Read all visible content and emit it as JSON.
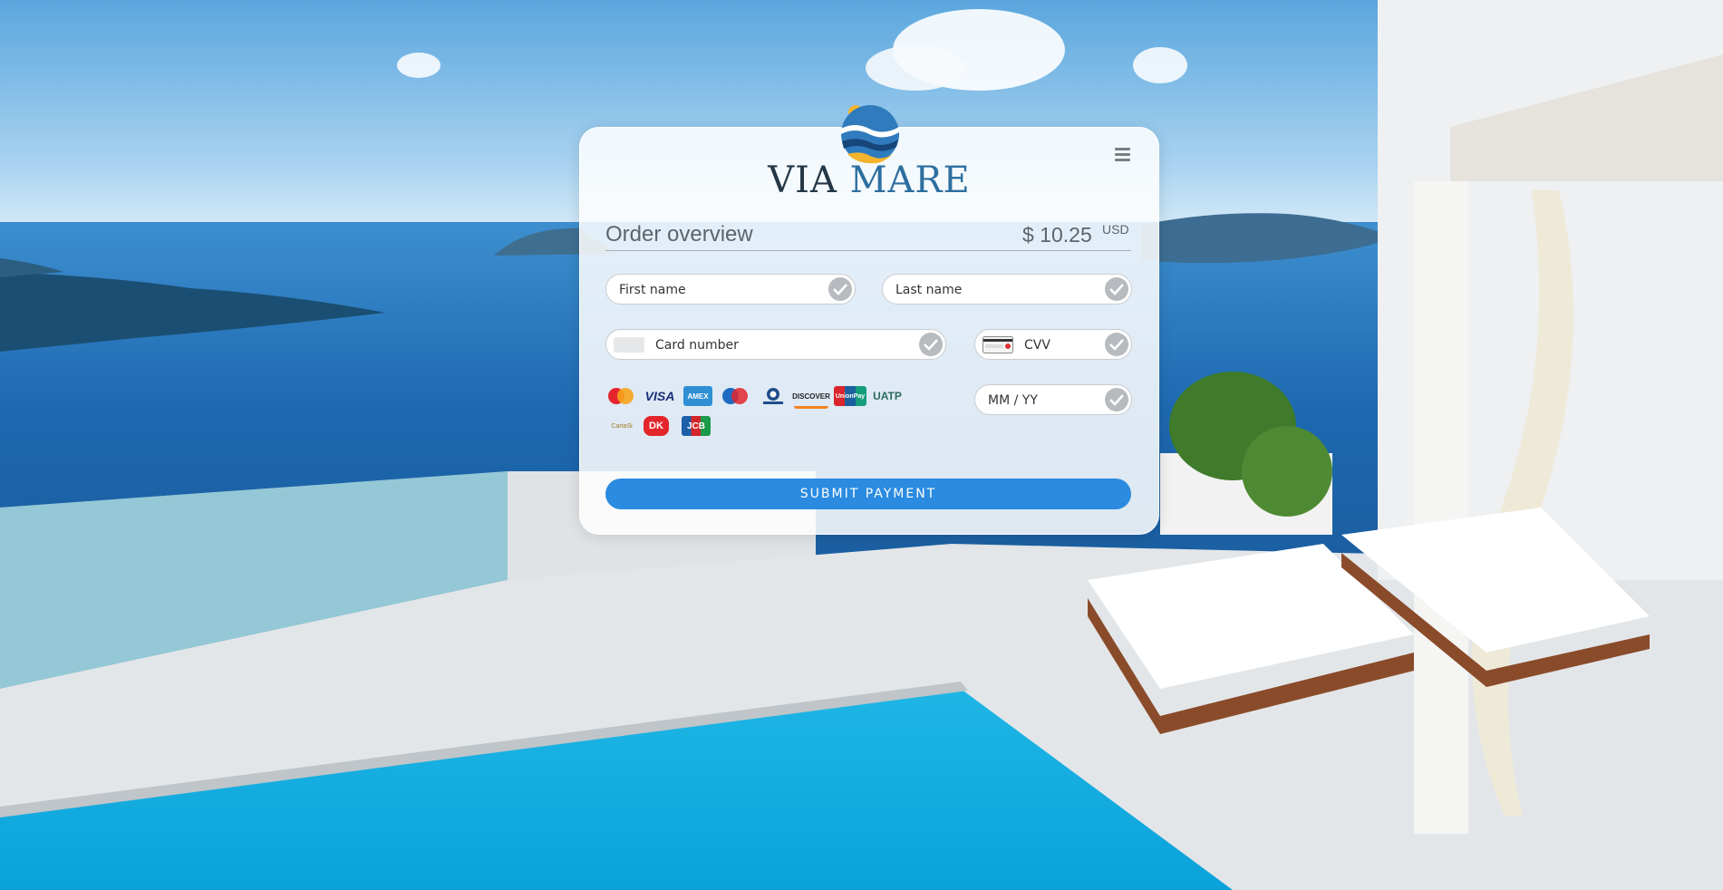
{
  "brand": {
    "name_part1": "VIA",
    "name_part2": "MARE",
    "logo_icon": "sun-waves-emblem-icon"
  },
  "header": {
    "menu_icon": "hamburger-menu-icon"
  },
  "order": {
    "title": "Order overview",
    "amount": "$ 10.25",
    "currency": "USD"
  },
  "form": {
    "first_name": {
      "placeholder": "First name",
      "value": ""
    },
    "last_name": {
      "placeholder": "Last name",
      "value": ""
    },
    "card_number": {
      "placeholder": "Card number",
      "value": ""
    },
    "cvv": {
      "placeholder": "CVV",
      "value": ""
    },
    "expiry": {
      "placeholder": "MM / YY",
      "value": ""
    }
  },
  "card_brands": [
    {
      "name": "MasterCard",
      "label": "MasterCard"
    },
    {
      "name": "Visa",
      "label": "VISA"
    },
    {
      "name": "American Express",
      "label": "AMEX"
    },
    {
      "name": "Maestro",
      "label": "Maestro"
    },
    {
      "name": "Diners Club",
      "label": "Diners Club"
    },
    {
      "name": "Discover",
      "label": "DISCOVER"
    },
    {
      "name": "UnionPay",
      "label": "UnionPay"
    },
    {
      "name": "UATP",
      "label": "UATP"
    },
    {
      "name": "CartaSi",
      "label": "CartaSi"
    },
    {
      "name": "Dankort",
      "label": "DK"
    },
    {
      "name": "JCB",
      "label": "JCB"
    }
  ],
  "submit": {
    "label": "SUBMIT PAYMENT"
  },
  "colors": {
    "accent": "#2a8be0",
    "check_bg": "#b7babe",
    "text": "#5d646b"
  }
}
